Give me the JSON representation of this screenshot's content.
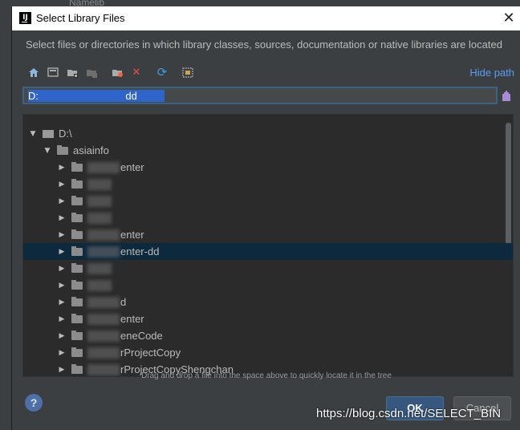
{
  "background": {
    "behind_label_1": "Name:",
    "behind_label_2": "lib"
  },
  "dialog": {
    "title": "Select Library Files",
    "description": "Select files or directories in which library classes, sources, documentation or native libraries are located",
    "close_icon": "close-icon"
  },
  "toolbar": {
    "buttons": [
      {
        "name": "home-icon"
      },
      {
        "name": "desktop-icon"
      },
      {
        "name": "project-folder-icon"
      },
      {
        "name": "module-folder-icon"
      },
      {
        "name": "new-folder-icon"
      },
      {
        "name": "delete-icon"
      },
      {
        "name": "refresh-icon"
      },
      {
        "name": "show-hidden-icon"
      }
    ],
    "hide_path_label": "Hide path"
  },
  "path": {
    "value": "D:                              dd"
  },
  "tree": {
    "items": [
      {
        "label": "D:\\",
        "level": 0,
        "expanded": true,
        "type": "drive"
      },
      {
        "label": "asiainfo",
        "level": 1,
        "expanded": true,
        "type": "folder"
      },
      {
        "label": "enter",
        "level": 2,
        "expanded": false,
        "type": "folder"
      },
      {
        "label": "",
        "level": 2,
        "expanded": false,
        "type": "folder"
      },
      {
        "label": "",
        "level": 2,
        "expanded": false,
        "type": "folder"
      },
      {
        "label": "",
        "level": 2,
        "expanded": false,
        "type": "folder"
      },
      {
        "label": "enter",
        "level": 2,
        "expanded": false,
        "type": "folder"
      },
      {
        "label": "enter-dd",
        "level": 2,
        "expanded": false,
        "type": "folder",
        "selected": true
      },
      {
        "label": "",
        "level": 2,
        "expanded": false,
        "type": "folder"
      },
      {
        "label": "",
        "level": 2,
        "expanded": false,
        "type": "folder"
      },
      {
        "label": "d",
        "level": 2,
        "expanded": false,
        "type": "folder"
      },
      {
        "label": "enter",
        "level": 2,
        "expanded": false,
        "type": "folder"
      },
      {
        "label": "eneCode",
        "level": 2,
        "expanded": false,
        "type": "folder"
      },
      {
        "label": "rProjectCopy",
        "level": 2,
        "expanded": false,
        "type": "folder"
      },
      {
        "label": "rProjectCopyShengchan",
        "level": 2,
        "expanded": false,
        "type": "folder"
      }
    ]
  },
  "hint": "Drag and drop a file into the space above to quickly locate it in the tree",
  "buttons": {
    "help": "?",
    "ok": "OK",
    "cancel": "Cancel"
  },
  "watermark": "https://blog.csdn.net/SELECT_BIN",
  "colors": {
    "accent": "#589df6",
    "selection": "#0d293e",
    "ok_button": "#365880"
  }
}
